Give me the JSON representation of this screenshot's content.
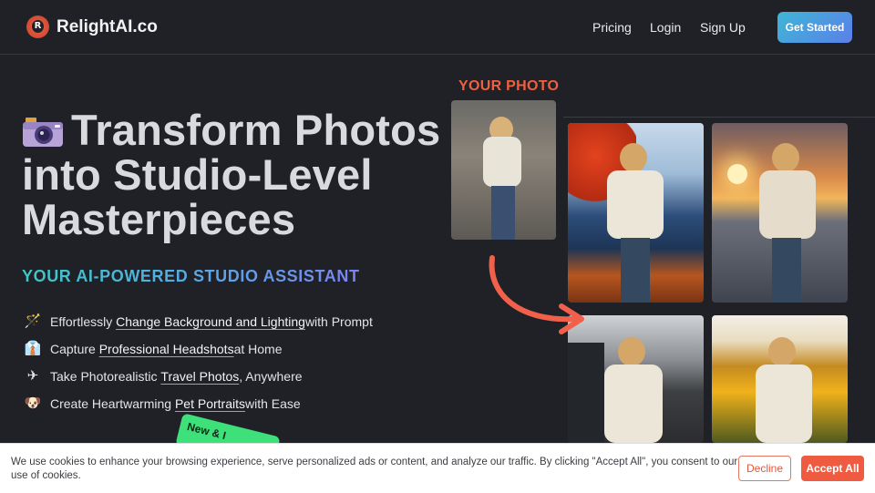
{
  "header": {
    "brand": "RelightAI.co",
    "nav": {
      "pricing": "Pricing",
      "login": "Login",
      "signup": "Sign Up"
    },
    "cta": "Get Started"
  },
  "hero": {
    "title": "Transform Photos into Studio-Level Masterpieces",
    "subtitle": "YOUR AI-POWERED STUDIO ASSISTANT",
    "features": [
      {
        "before": "Effortlessly ",
        "link": "Change Background and Lighting",
        "after": " with Prompt",
        "icon": "magic-wand-icon"
      },
      {
        "before": "Capture ",
        "link": "Professional Headshots",
        "after": " at Home",
        "icon": "businessperson-icon"
      },
      {
        "before": "Take Photorealistic ",
        "link": "Travel Photos",
        "after": ", Anywhere",
        "icon": "airplane-icon"
      },
      {
        "before": "Create Heartwarming ",
        "link": "Pet Portraits",
        "after": " with Ease",
        "icon": "dog-icon"
      }
    ],
    "badge": "New & I"
  },
  "gallery": {
    "your_photo_label": "YOUR PHOTO"
  },
  "cookie": {
    "text": "We use cookies to enhance your browsing experience, serve personalized ads or content, and analyze our traffic. By clicking \"Accept All\", you consent to our use of cookies.",
    "decline": "Decline",
    "accept": "Accept All"
  },
  "colors": {
    "background": "#1f2126",
    "accent_orange": "#ef5b40",
    "cta_gradient_start": "#3fb6d6",
    "cta_gradient_end": "#5b7fe8",
    "badge_green": "#3ee07a"
  }
}
